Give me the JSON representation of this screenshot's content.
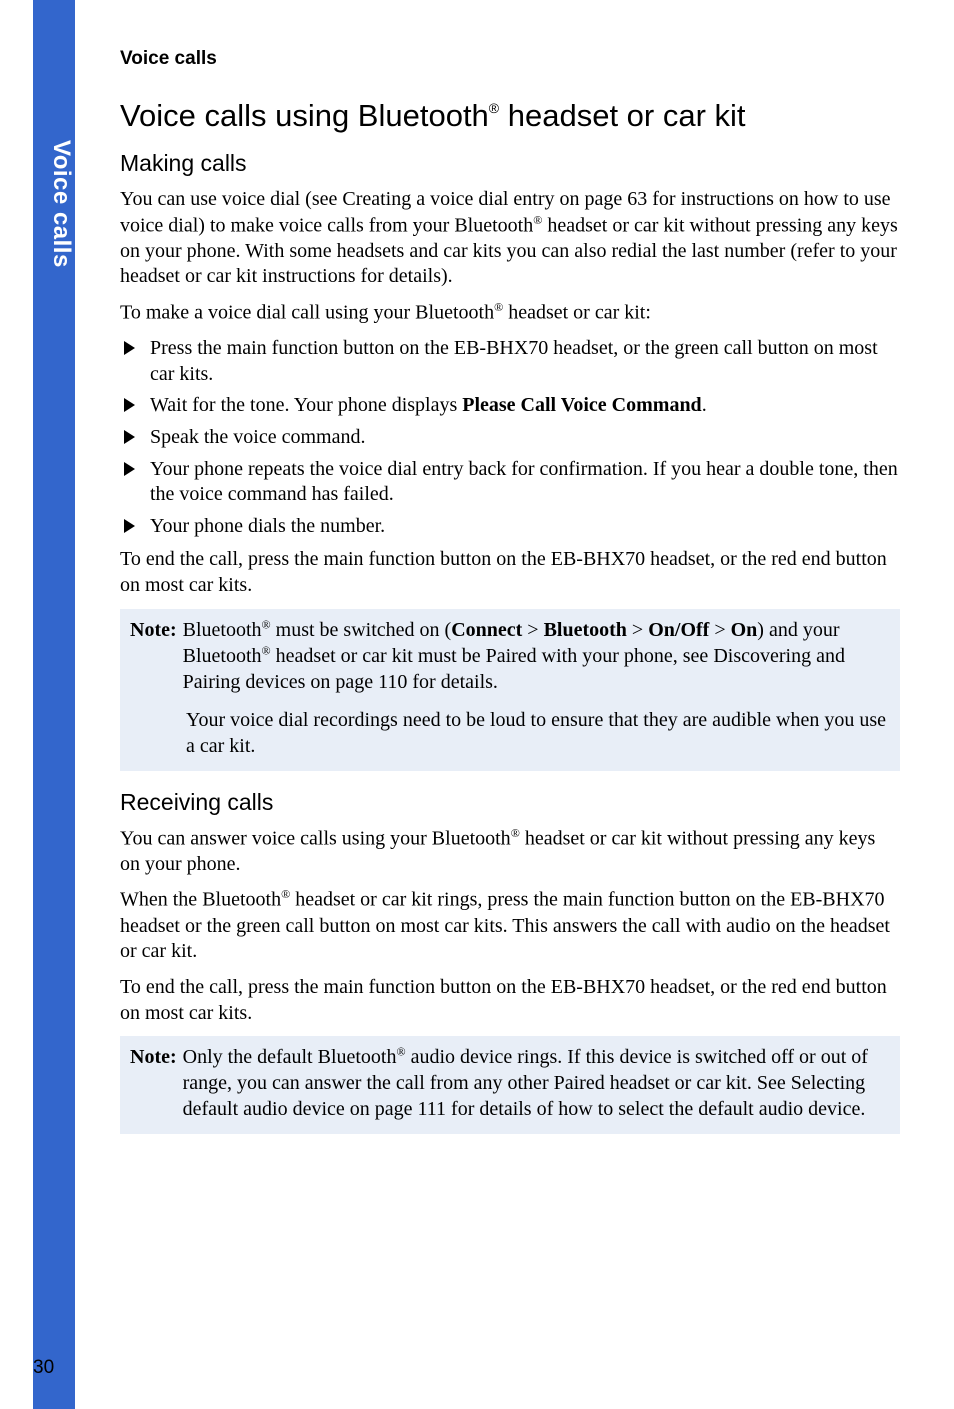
{
  "side_tab": {
    "label": "Voice calls"
  },
  "running_head": "Voice calls",
  "title": {
    "pre": "Voice calls using Bluetooth",
    "reg": "®",
    "post": " headset or car kit"
  },
  "making": {
    "heading": "Making calls",
    "p1a": "You can use voice dial (see Creating a voice dial entry on page 63 for instructions on how to use voice dial) to make voice calls from your Bluetooth",
    "p1b": " headset or car kit without pressing any keys on your phone. With some headsets and car kits you can also redial the last number (refer to your headset or car kit instructions for details).",
    "p2a": "To make a voice dial call using your Bluetooth",
    "p2b": " headset or car kit:",
    "steps": {
      "s1": "Press the main function button on the EB-BHX70 headset, or the green call button on most car kits.",
      "s2a": "Wait for the tone. Your phone displays ",
      "s2b": "Please Call Voice Command",
      "s2c": ".",
      "s3": "Speak the voice command.",
      "s4": "Your phone repeats the voice dial entry back for confirmation. If you hear a double tone, then the voice command has failed.",
      "s5": "Your phone dials the number."
    },
    "p3": "To end the call, press the main function button on the EB-BHX70 headset, or the red end button on most car kits."
  },
  "note1": {
    "label": "Note:",
    "t1": "Bluetooth",
    "t2": " must be switched on (",
    "b1": "Connect",
    "gt1": " > ",
    "b2": "Bluetooth",
    "gt2": " > ",
    "b3": "On/Off",
    "gt3": " > ",
    "b4": "On",
    "t3": ") and your Bluetooth",
    "t4": " headset or car kit must be Paired with your phone, see Discovering and Pairing devices on page 110 for details.",
    "p2": "Your voice dial recordings need to be loud to ensure that they are audible when you use a car kit."
  },
  "receiving": {
    "heading": "Receiving calls",
    "p1a": "You can answer voice calls using your Bluetooth",
    "p1b": " headset or car kit without pressing any keys on your phone.",
    "p2a": "When the Bluetooth",
    "p2b": " headset or car kit rings, press the main function button on the EB-BHX70 headset or the green call button on most car kits. This answers the call with audio on the headset or car kit.",
    "p3": "To end the call, press the main function button on the EB-BHX70 headset, or the red end button on most car kits."
  },
  "note2": {
    "label": "Note:",
    "t1": "Only the default Bluetooth",
    "t2": " audio device rings. If this device is switched off or out of range, you can answer the call from any other Paired headset or car kit. See Selecting default audio device on page 111 for details of how to select the default audio device."
  },
  "reg": "®",
  "page_number": "30"
}
